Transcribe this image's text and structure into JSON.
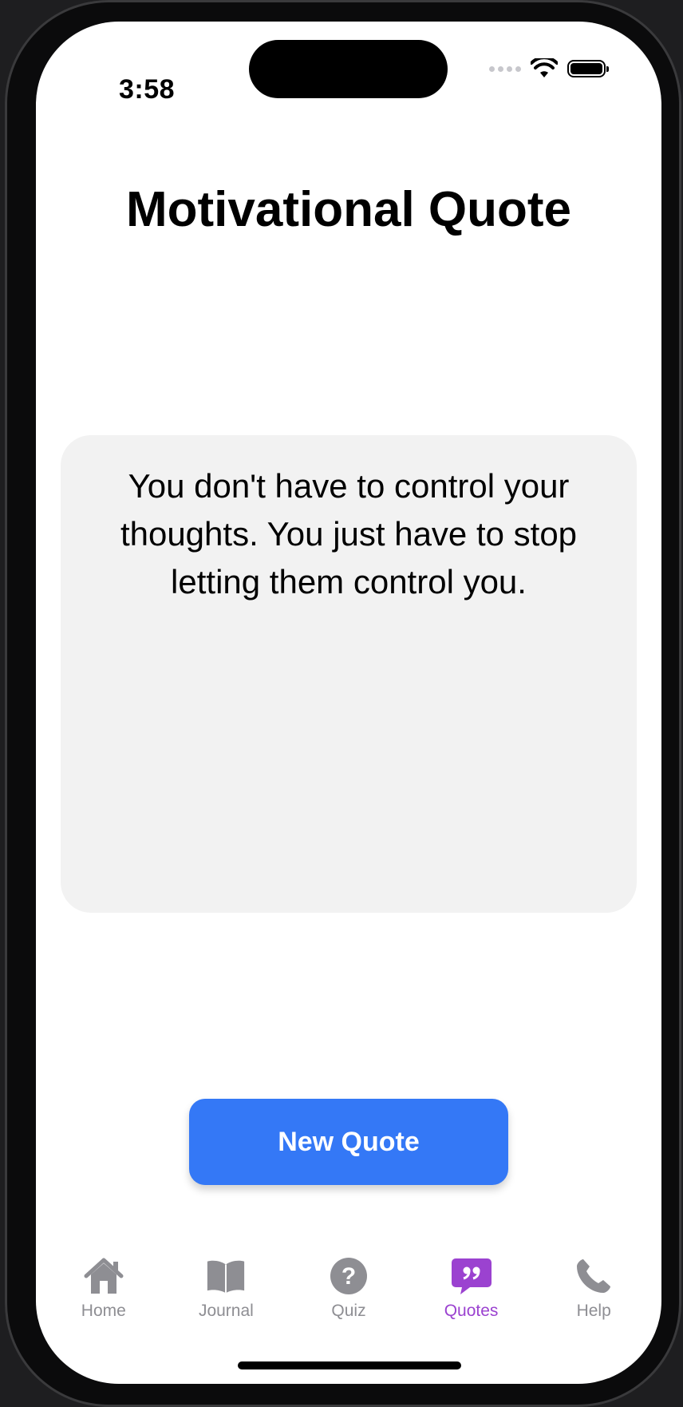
{
  "status_bar": {
    "time": "3:58"
  },
  "page": {
    "title": "Motivational Quote"
  },
  "quote": {
    "text": "You don't have to control your thoughts. You just have to stop letting them control you."
  },
  "actions": {
    "new_quote_label": "New Quote"
  },
  "tab_bar": {
    "items": [
      {
        "label": "Home",
        "icon": "house-icon",
        "active": false
      },
      {
        "label": "Journal",
        "icon": "book-icon",
        "active": false
      },
      {
        "label": "Quiz",
        "icon": "question-circle-icon",
        "active": false
      },
      {
        "label": "Quotes",
        "icon": "quote-bubble-icon",
        "active": true
      },
      {
        "label": "Help",
        "icon": "phone-icon",
        "active": false
      }
    ]
  },
  "colors": {
    "accent": "#3478f6",
    "active_tab": "#9b42d0",
    "inactive_tab": "#8e8e93",
    "card_background": "#f2f2f2"
  }
}
